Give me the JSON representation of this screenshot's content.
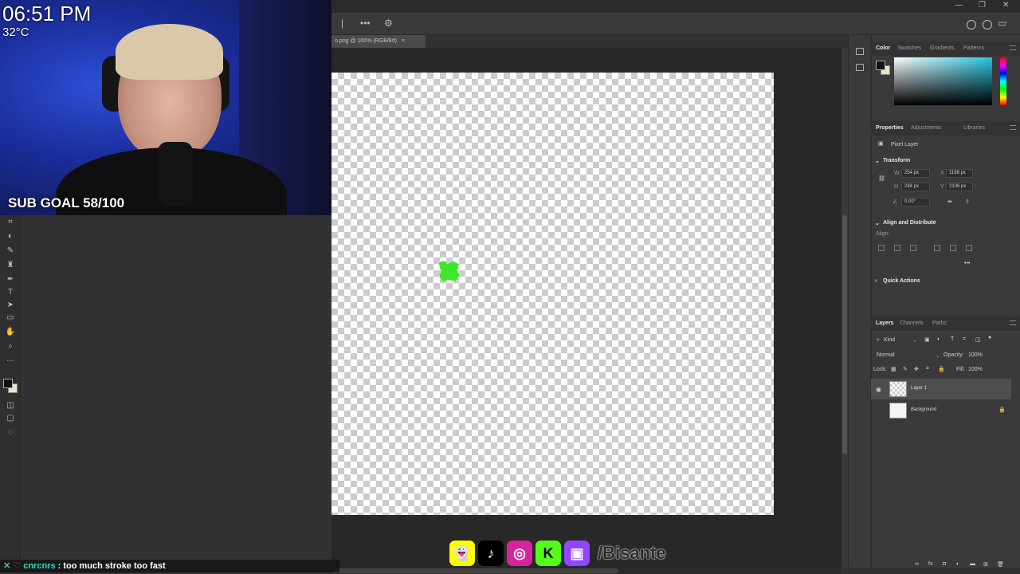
{
  "stream": {
    "clock": "06:51 PM",
    "temperature": "32°C",
    "sub_goal": "SUB GOAL 58/100",
    "handle": "/Bisante",
    "chat": {
      "username": "cnrcnrs",
      "message": ": too much stroke too fast"
    },
    "socials": [
      {
        "name": "snapchat-icon",
        "glyph": "👻",
        "color": "#fffc00"
      },
      {
        "name": "tiktok-icon",
        "glyph": "♪",
        "color": "#000000"
      },
      {
        "name": "instagram-icon",
        "glyph": "◎",
        "color": "#d6249f"
      },
      {
        "name": "kick-icon",
        "glyph": "K",
        "color": "#53fc18"
      },
      {
        "name": "twitch-icon",
        "glyph": "▣",
        "color": "#9146ff"
      }
    ]
  },
  "document": {
    "tab_label": "o.png @ 100% (RGB/8#)",
    "shape_color": "#3ee62a"
  },
  "panels": {
    "color_tabs": [
      "Color",
      "Swatches",
      "Gradients",
      "Patterns"
    ],
    "properties_tabs": [
      "Properties",
      "Adjustments",
      "Libraries"
    ],
    "layer_type": "Pixel Layer",
    "transform": {
      "title": "Transform",
      "w_label": "W",
      "w_value": "254 px",
      "h_label": "H",
      "h_value": "284 px",
      "x_label": "X",
      "x_value": "1198 px",
      "y_label": "Y",
      "y_value": "2106 px",
      "angle": "0.00°"
    },
    "align": {
      "title": "Align and Distribute",
      "label": "Align:"
    },
    "quick_actions": "Quick Actions",
    "layers_tabs": [
      "Layers",
      "Channels",
      "Paths"
    ],
    "kind_label": "Kind",
    "blend_mode": "Normal",
    "opacity_label": "Opacity:",
    "opacity_value": "100%",
    "lock_label": "Lock:",
    "fill_label": "Fill:",
    "fill_value": "100%",
    "layers": [
      {
        "name": "Layer 1",
        "selected": true
      },
      {
        "name": "Background",
        "selected": false
      }
    ]
  },
  "colors": {
    "accent_green": "#3ee62a",
    "panel_bg": "#3a3a3a"
  }
}
